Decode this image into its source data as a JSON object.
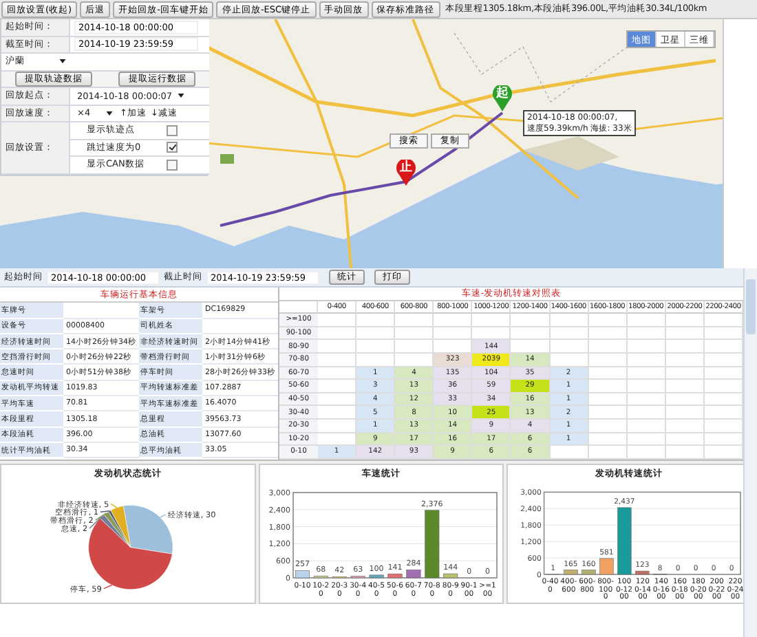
{
  "toolbar": {
    "buttons": [
      "回放设置(收起)",
      "后退",
      "开始回放-回车键开始",
      "停止回放-ESC键停止",
      "手动回放",
      "保存标准路径"
    ],
    "summary": "本段里程1305.18km,本段油耗396.00L,平均油耗30.34L/100km"
  },
  "playback_panel": {
    "start_time": {
      "label": "起始时间：",
      "value": "2014-10-18 00:00:00"
    },
    "end_time": {
      "label": "截至时间：",
      "value": "2014-10-19 23:59:59"
    },
    "plate_dropdown": "沪蘭",
    "buttons": [
      "提取轨迹数据",
      "提取运行数据"
    ],
    "start_point": {
      "label": "回放起点：",
      "value": "2014-10-18 00:00:07"
    },
    "speed": {
      "label": "回放速度：",
      "value": "×4",
      "faster": "↑加速",
      "slower": "↓减速"
    },
    "settings": {
      "label": "回放设置：",
      "options": [
        {
          "label": "显示轨迹点",
          "checked": false
        },
        {
          "label": "跳过速度为0",
          "checked": true
        },
        {
          "label": "显示CAN数据",
          "checked": false
        }
      ]
    }
  },
  "map": {
    "kind": "picture",
    "map_types": [
      {
        "label": "地图",
        "selected": true
      },
      {
        "label": "卫星",
        "selected": false
      },
      {
        "label": "三维",
        "selected": false
      }
    ],
    "start_marker": "起",
    "end_marker": "止",
    "info": [
      "2014-10-18 00:00:07,",
      "速度59.39km/h 海拔: 33米"
    ],
    "menu": [
      "搜索",
      "复制"
    ]
  },
  "stats_bar": {
    "start": {
      "label": "起始时间",
      "value": "2014-10-18 00:00:00"
    },
    "end": {
      "label": "截止时间",
      "value": "2014-10-19 23:59:59"
    },
    "buttons": [
      "统计",
      "打印"
    ]
  },
  "vehicle_info": {
    "title": "车辆运行基本信息",
    "rows": [
      [
        {
          "label": "车牌号"
        },
        {
          "label": "车架号",
          "value": "DC169829"
        }
      ],
      [
        {
          "label": "设备号",
          "value": "00008400"
        },
        {
          "label": "司机姓名"
        }
      ],
      [
        {
          "label": "经济转速时间",
          "value": "14小时26分钟34秒"
        },
        {
          "label": "非经济转速时间",
          "value": "2小时14分钟41秒"
        }
      ],
      [
        {
          "label": "空挡滑行时间",
          "value": "0小时26分钟22秒"
        },
        {
          "label": "带档滑行时间",
          "value": "1小时31分钟6秒"
        }
      ],
      [
        {
          "label": "怠速时间",
          "value": "0小时51分钟38秒"
        },
        {
          "label": "停车时间",
          "value": "28小时26分钟33秒"
        }
      ],
      [
        {
          "label": "发动机平均转速",
          "value": "1019.83"
        },
        {
          "label": "平均转速标准差",
          "value": "107.2887"
        }
      ],
      [
        {
          "label": "平均车速",
          "value": "70.81"
        },
        {
          "label": "平均车速标准差",
          "value": "16.4070"
        }
      ],
      [
        {
          "label": "本段里程",
          "value": "1305.18"
        },
        {
          "label": "总里程",
          "value": "39563.73"
        }
      ],
      [
        {
          "label": "本段油耗",
          "value": "396.00"
        },
        {
          "label": "总油耗",
          "value": "13077.60"
        }
      ],
      [
        {
          "label": "统计平均油耗",
          "value": "30.34"
        },
        {
          "label": "总平均油耗",
          "value": "33.05"
        }
      ]
    ]
  },
  "speed_rpm_table": {
    "title": "车速-发动机转速对照表",
    "columns": [
      "0-400",
      "400-600",
      "600-800",
      "800-1000",
      "1000-1200",
      "1200-1400",
      "1400-1600",
      "1600-1800",
      "1800-2000",
      "2000-2200",
      "2200-2400"
    ],
    "rows": [
      {
        "label": ">=100",
        "cells": [
          null,
          null,
          null,
          null,
          null,
          null,
          null,
          null,
          null,
          null,
          null
        ]
      },
      {
        "label": "90-100",
        "cells": [
          null,
          null,
          null,
          null,
          null,
          null,
          null,
          null,
          null,
          null,
          null
        ]
      },
      {
        "label": "80-90",
        "cells": [
          null,
          null,
          null,
          null,
          {
            "value": "144",
            "color": "#e6e0ee"
          },
          null,
          null,
          null,
          null,
          null,
          null
        ]
      },
      {
        "label": "70-80",
        "cells": [
          null,
          null,
          null,
          {
            "value": "323",
            "color": "#eadcd4"
          },
          {
            "value": "2039",
            "color": "#eee81c"
          },
          {
            "value": "14",
            "color": "#d8e9c0"
          },
          null,
          null,
          null,
          null,
          null
        ]
      },
      {
        "label": "60-70",
        "cells": [
          null,
          {
            "value": "1",
            "color": "#d6e6f4"
          },
          {
            "value": "4",
            "color": "#d8e9c0"
          },
          {
            "value": "135",
            "color": "#e6e0ee"
          },
          {
            "value": "104",
            "color": "#e6e0ee"
          },
          {
            "value": "35",
            "color": "#e6e0ee"
          },
          {
            "value": "2",
            "color": "#d6e6f4"
          },
          null,
          null,
          null,
          null
        ]
      },
      {
        "label": "50-60",
        "cells": [
          null,
          {
            "value": "3",
            "color": "#d6e6f4"
          },
          {
            "value": "13",
            "color": "#d8e9c0"
          },
          {
            "value": "36",
            "color": "#e6e0ee"
          },
          {
            "value": "59",
            "color": "#e6e0ee"
          },
          {
            "value": "29",
            "color": "#c6e01a"
          },
          {
            "value": "1",
            "color": "#d6e6f4"
          },
          null,
          null,
          null,
          null
        ]
      },
      {
        "label": "40-50",
        "cells": [
          null,
          {
            "value": "4",
            "color": "#d6e6f4"
          },
          {
            "value": "12",
            "color": "#d8e9c0"
          },
          {
            "value": "33",
            "color": "#e6e0ee"
          },
          {
            "value": "34",
            "color": "#e6e0ee"
          },
          {
            "value": "16",
            "color": "#d8e9c0"
          },
          {
            "value": "1",
            "color": "#d6e6f4"
          },
          null,
          null,
          null,
          null
        ]
      },
      {
        "label": "30-40",
        "cells": [
          null,
          {
            "value": "5",
            "color": "#d6e6f4"
          },
          {
            "value": "8",
            "color": "#d8e9c0"
          },
          {
            "value": "10",
            "color": "#d8e9c0"
          },
          {
            "value": "25",
            "color": "#c6e01a"
          },
          {
            "value": "13",
            "color": "#d8e9c0"
          },
          {
            "value": "2",
            "color": "#d6e6f4"
          },
          null,
          null,
          null,
          null
        ]
      },
      {
        "label": "20-30",
        "cells": [
          null,
          {
            "value": "1",
            "color": "#d6e6f4"
          },
          {
            "value": "13",
            "color": "#d8e9c0"
          },
          {
            "value": "14",
            "color": "#d8e9c0"
          },
          {
            "value": "9",
            "color": "#e6e0ee"
          },
          {
            "value": "4",
            "color": "#e6e0ee"
          },
          {
            "value": "1",
            "color": "#d6e6f4"
          },
          null,
          null,
          null,
          null
        ]
      },
      {
        "label": "10-20",
        "cells": [
          null,
          {
            "value": "9",
            "color": "#d8e9c0"
          },
          {
            "value": "17",
            "color": "#d8e9c0"
          },
          {
            "value": "16",
            "color": "#d8e9c0"
          },
          {
            "value": "17",
            "color": "#d8e9c0"
          },
          {
            "value": "6",
            "color": "#d8e9c0"
          },
          {
            "value": "1",
            "color": "#d6e6f4"
          },
          null,
          null,
          null,
          null
        ]
      },
      {
        "label": "0-10",
        "cells": [
          {
            "value": "1",
            "color": "#d6e6f4"
          },
          {
            "value": "142",
            "color": "#e6e0ee"
          },
          {
            "value": "93",
            "color": "#e6e0ee"
          },
          {
            "value": "9",
            "color": "#d8e9c0"
          },
          {
            "value": "6",
            "color": "#d8e9c0"
          },
          {
            "value": "6",
            "color": "#d8e9c0"
          },
          null,
          null,
          null,
          null,
          null
        ]
      }
    ]
  },
  "charts": [
    {
      "chart_data": {
        "type": "pie",
        "title": "发动机状态统计",
        "categories": [
          "经济转速, 30",
          "停车, 59",
          "怠速, 2",
          "带档滑行, 2",
          "空档滑行, 1",
          "非经济转速, 5"
        ],
        "values": [
          30,
          59,
          2,
          2,
          1,
          5
        ]
      }
    },
    {
      "chart_data": {
        "type": "bar",
        "title": "车速统计",
        "categories": [
          "0-10",
          "10-20",
          "20-30",
          "30-40",
          "40-50",
          "50-60",
          "60-70",
          "70-80",
          "80-90",
          "90-100",
          ">=100"
        ],
        "values": [
          257,
          68,
          42,
          63,
          100,
          141,
          284,
          2376,
          144,
          0,
          0
        ],
        "ylim": [
          0,
          3000
        ],
        "yticks": [
          {
            "value": 0,
            "label": "0"
          },
          {
            "value": 600,
            "label": "600"
          },
          {
            "value": 1200,
            "label": "1,200"
          },
          {
            "value": 1800,
            "label": "1,800"
          },
          {
            "value": 2400,
            "label": "2,400"
          },
          {
            "value": 3000,
            "label": "3,000"
          }
        ],
        "grid": true,
        "value_labels": [
          "257",
          "68",
          "42",
          "63",
          "100",
          "141",
          "284",
          "2,376",
          "144",
          "0",
          "0"
        ]
      }
    },
    {
      "chart_data": {
        "type": "bar",
        "title": "发动机转速统计",
        "categories": [
          "0-400",
          "400-600",
          "600-800",
          "800-1000",
          "1000-1200",
          "1200-1400",
          "1400-1600",
          "1600-1800",
          "1800-2000",
          "2000-2200",
          "2200-2400"
        ],
        "values": [
          1,
          165,
          160,
          581,
          2437,
          123,
          8,
          0,
          0,
          0,
          0
        ],
        "ylim": [
          0,
          3000
        ],
        "yticks": [
          {
            "value": 0,
            "label": "0"
          },
          {
            "value": 600,
            "label": "600"
          },
          {
            "value": 1200,
            "label": "1,200"
          },
          {
            "value": 1800,
            "label": "1,800"
          },
          {
            "value": 2400,
            "label": "2,400"
          },
          {
            "value": 3000,
            "label": "3,000"
          }
        ],
        "grid": true,
        "value_labels": [
          "1",
          "165",
          "160",
          "581",
          "2,437",
          "123",
          "8",
          "0",
          "0",
          "0",
          "0"
        ]
      }
    }
  ]
}
